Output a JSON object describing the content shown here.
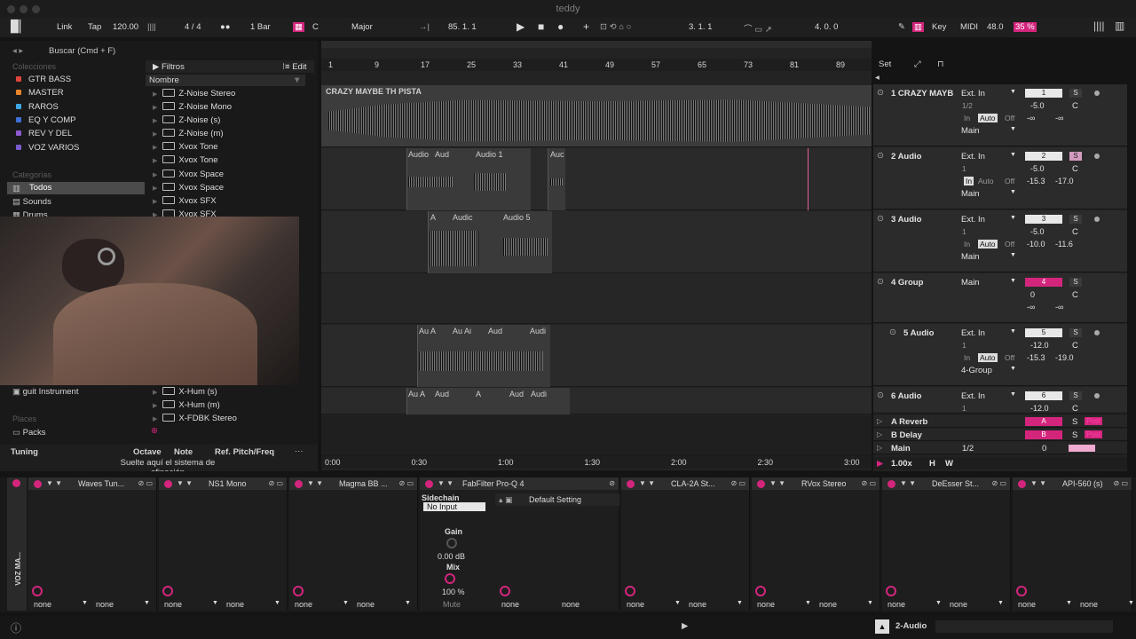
{
  "window": {
    "title": "teddy"
  },
  "transport": {
    "link": "Link",
    "tap": "Tap",
    "tempo": "120.00",
    "sig": "4 / 4",
    "quant": "1 Bar",
    "key_root": "C",
    "scale": "Major",
    "pos": "85.  1.  1",
    "loop_start": "3.  1.  1",
    "loop_len": "4.  0.  0",
    "key": "Key",
    "midi": "MIDI",
    "cpu_val": "48.0",
    "cpu_pct": "35 %"
  },
  "browser": {
    "search": "Buscar (Cmd + F)",
    "filters": "Filtros",
    "edit": "Edit",
    "name_col": "Nombre",
    "collections_h": "Colecciones",
    "collections": [
      {
        "label": "GTR BASS",
        "color": "#e0443a"
      },
      {
        "label": "MASTER",
        "color": "#e8842a"
      },
      {
        "label": "RAROS",
        "color": "#3ea8e6"
      },
      {
        "label": "EQ Y COMP",
        "color": "#3f6fd6"
      },
      {
        "label": "REV Y DEL",
        "color": "#8d5bd4"
      },
      {
        "label": "VOZ VARIOS",
        "color": "#7b5bd0"
      }
    ],
    "categories_h": "Categorías",
    "cat_all": "Todos",
    "cat_sounds": "Sounds",
    "cat_drums": "Drums",
    "files": [
      "Z-Noise Stereo",
      "Z-Noise Mono",
      "Z-Noise (s)",
      "Z-Noise (m)",
      "Xvox Tone",
      "Xvox Tone",
      "Xvox Space",
      "Xvox Space",
      "Xvox SFX",
      "Xvox SFX",
      "X-Hum (s)",
      "X-Hum (m)",
      "X-FDBK Stereo"
    ],
    "guit": "guit Instrument",
    "places": "Places",
    "packs": "Packs",
    "tuning": "Tuning",
    "octave": "Octave",
    "note": "Note",
    "refpitch": "Ref. Pitch/Freq",
    "drop_hint": "Suelte aquí el sistema de afinación"
  },
  "arrangement": {
    "ruler": [
      "1",
      "9",
      "17",
      "25",
      "33",
      "41",
      "49",
      "57",
      "65",
      "73",
      "81",
      "89"
    ],
    "set": "Set",
    "time": [
      "0:00",
      "0:30",
      "1:00",
      "1:30",
      "2:00",
      "2:30",
      "3:00"
    ],
    "t1clip": "CRAZY MAYBE TH PISTA",
    "t2clips": [
      "Audio",
      "Aud",
      "Audio 1",
      "Auc"
    ],
    "t3clips": [
      "A",
      "Audic",
      "Audio 5"
    ],
    "t5clips": [
      "Au A",
      "Au Ai",
      "Aud",
      "Audi"
    ],
    "t6clips": [
      "Au A",
      "Aud",
      "A",
      "Aud",
      "Audi"
    ]
  },
  "mixer": {
    "tracks": [
      {
        "name": "1 CRAZY MAYB",
        "input": "Ext. In",
        "ch": "1/2",
        "num": "1",
        "vol": "-5.0",
        "pan": "C",
        "l": "-∞",
        "r": "-∞",
        "out": "Main"
      },
      {
        "name": "2 Audio",
        "input": "Ext. In",
        "ch": "1",
        "num": "2",
        "vol": "-5.0",
        "pan": "C",
        "l": "-15.3",
        "r": "-17.0",
        "out": "Main"
      },
      {
        "name": "3 Audio",
        "input": "Ext. In",
        "ch": "1",
        "num": "3",
        "vol": "-5.0",
        "pan": "C",
        "l": "-10.0",
        "r": "-11.6",
        "out": "Main"
      },
      {
        "name": "4 Group",
        "input": "Main",
        "ch": "",
        "num": "4",
        "vol": "0",
        "pan": "C",
        "l": "-∞",
        "r": "-∞",
        "out": ""
      },
      {
        "name": "5 Audio",
        "input": "Ext. In",
        "ch": "1",
        "num": "5",
        "vol": "-12.0",
        "pan": "C",
        "l": "-15.3",
        "r": "-19.0",
        "out": "4-Group"
      },
      {
        "name": "6 Audio",
        "input": "Ext. In",
        "ch": "1",
        "num": "6",
        "vol": "-12.0",
        "pan": "C",
        "l": "",
        "r": "",
        "out": ""
      }
    ],
    "in": "In",
    "auto": "Auto",
    "off": "Off",
    "s": "S",
    "returns": [
      "A Reverb",
      "B Delay"
    ],
    "ret_letters": [
      "A",
      "B"
    ],
    "post": "Post",
    "main": "Main",
    "main_ch": "1/2",
    "main_vol": "0",
    "zoom": "1.00x",
    "h": "H",
    "w": "W"
  },
  "devices": {
    "track_label": "VOZ MA...",
    "items": [
      {
        "name": "Waves Tun...",
        "a": "none",
        "b": "none"
      },
      {
        "name": "NS1 Mono",
        "a": "none",
        "b": "none"
      },
      {
        "name": "Magma BB ...",
        "a": "none",
        "b": "none"
      },
      {
        "name": "FabFilter Pro-Q 4",
        "a": "none",
        "b": "none"
      },
      {
        "name": "CLA-2A St...",
        "a": "none",
        "b": "none"
      },
      {
        "name": "RVox Stereo",
        "a": "none",
        "b": "none"
      },
      {
        "name": "DeEsser St...",
        "a": "none",
        "b": "none"
      },
      {
        "name": "API-560 (s)",
        "a": "none",
        "b": "none"
      }
    ],
    "sidechain": "Sidechain",
    "no_input": "No Input",
    "gain": "Gain",
    "gain_val": "0.00 dB",
    "mix": "Mix",
    "mix_val": "100 %",
    "mute": "Mute",
    "preset": "Default Setting"
  },
  "status": {
    "track": "2-Audio"
  }
}
